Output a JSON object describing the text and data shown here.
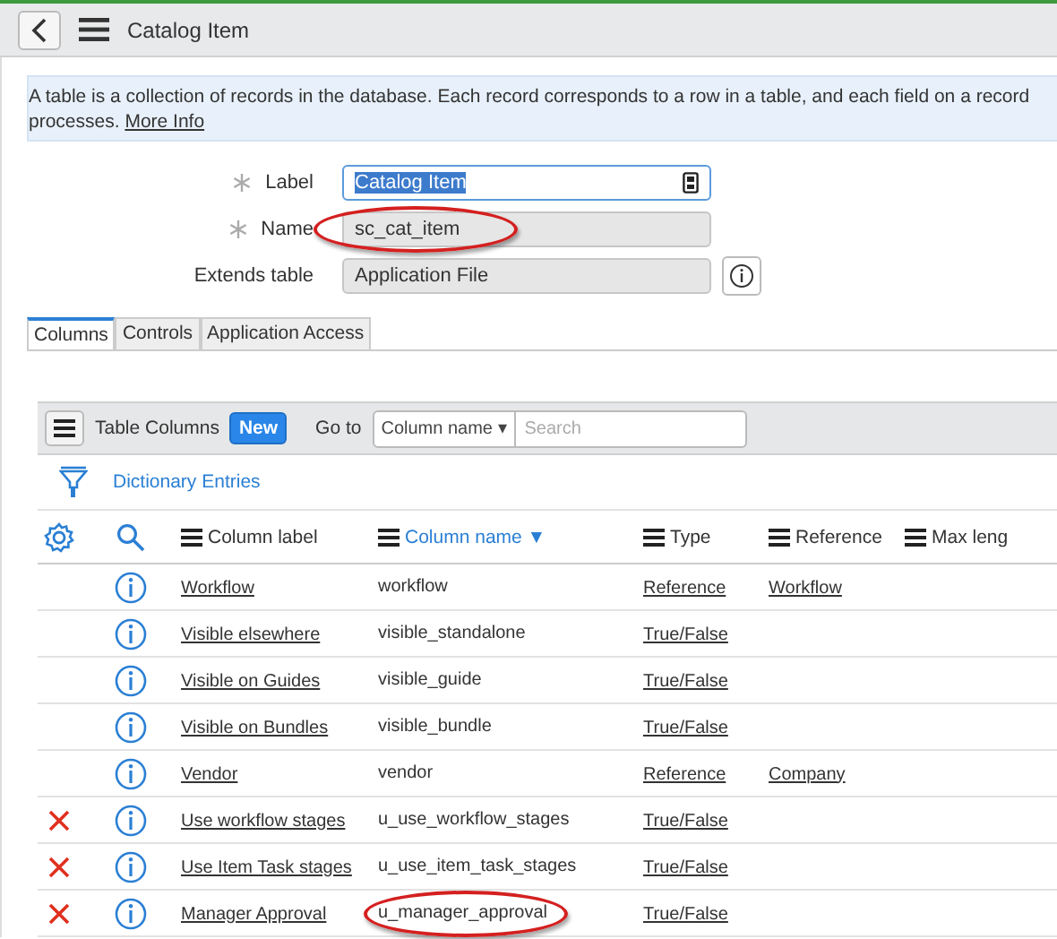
{
  "header": {
    "title": "Catalog Item"
  },
  "info": {
    "text": "A table is a collection of records in the database. Each record corresponds to a row in a table, and each field on a record",
    "text_2": "processes.",
    "link": "More Info"
  },
  "form": [
    {
      "label": "Label",
      "required": true,
      "value": "Catalog Item",
      "kind": "editable",
      "highlighted": false
    },
    {
      "label": "Name",
      "required": true,
      "value": "sc_cat_item",
      "kind": "readonly",
      "highlighted": true
    },
    {
      "label": "Extends table",
      "required": false,
      "value": "Application File",
      "kind": "reference",
      "highlighted": false
    }
  ],
  "tabs": [
    {
      "label": "Columns",
      "selected": true
    },
    {
      "label": "Controls",
      "selected": false
    },
    {
      "label": "Application Access",
      "selected": false
    }
  ],
  "list": {
    "title": "Table Columns",
    "new_button": "New",
    "goto_label": "Go to",
    "goto_field": "Column name ▾",
    "search_placeholder": "Search",
    "breadcrumb": "Dictionary Entries",
    "columns": [
      {
        "label": "Column label",
        "sorted": false
      },
      {
        "label": "Column name ▼",
        "sorted": true
      },
      {
        "label": "Type",
        "sorted": false
      },
      {
        "label": "Reference",
        "sorted": false
      },
      {
        "label": "Max leng",
        "sorted": false
      }
    ],
    "rows": [
      {
        "removable": false,
        "label": "Workflow",
        "name": "workflow",
        "type": "Reference",
        "reference": "Workflow",
        "highlighted": false
      },
      {
        "removable": false,
        "label": "Visible elsewhere",
        "name": "visible_standalone",
        "type": "True/False",
        "reference": "",
        "highlighted": false
      },
      {
        "removable": false,
        "label": "Visible on Guides",
        "name": "visible_guide",
        "type": "True/False",
        "reference": "",
        "highlighted": false
      },
      {
        "removable": false,
        "label": "Visible on Bundles",
        "name": "visible_bundle",
        "type": "True/False",
        "reference": "",
        "highlighted": false
      },
      {
        "removable": false,
        "label": "Vendor",
        "name": "vendor",
        "type": "Reference",
        "reference": "Company",
        "highlighted": false
      },
      {
        "removable": true,
        "label": "Use workflow stages",
        "name": "u_use_workflow_stages",
        "type": "True/False",
        "reference": "",
        "highlighted": false
      },
      {
        "removable": true,
        "label": "Use Item Task stages",
        "name": "u_use_item_task_stages",
        "type": "True/False",
        "reference": "",
        "highlighted": false
      },
      {
        "removable": true,
        "label": "Manager Approval",
        "name": "u_manager_approval",
        "type": "True/False",
        "reference": "",
        "highlighted": true
      }
    ]
  }
}
